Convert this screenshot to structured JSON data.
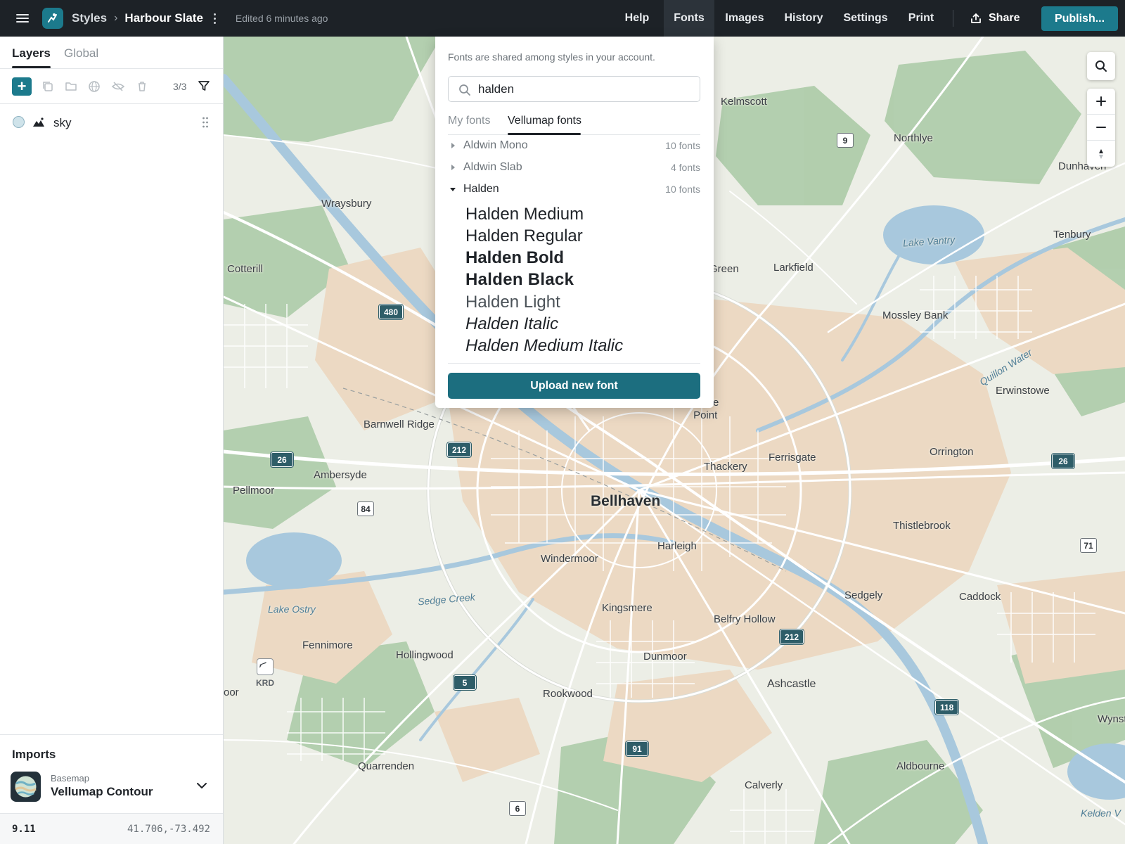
{
  "header": {
    "breadcrumb_root": "Styles",
    "breadcrumb_sep": "›",
    "style_name": "Harbour Slate",
    "edited": "Edited 6 minutes ago",
    "nav": [
      "Help",
      "Fonts",
      "Images",
      "History",
      "Settings",
      "Print"
    ],
    "active_nav": "Fonts",
    "share_label": "Share",
    "publish_label": "Publish..."
  },
  "left_panel": {
    "tabs": [
      "Layers",
      "Global"
    ],
    "active_tab": "Layers",
    "layer_count": "3/3",
    "layers": [
      {
        "name": "sky",
        "type_icon": "mountain-icon"
      }
    ],
    "imports_title": "Imports",
    "basemap_label": "Basemap",
    "basemap_name": "Vellumap Contour",
    "zoom": "9.11",
    "coordinates": "41.706,-73.492"
  },
  "font_panel": {
    "note": "Fonts are shared among styles in your account.",
    "search_value": "halden",
    "tabs": [
      "My fonts",
      "Vellumap fonts"
    ],
    "active_tab": "Vellumap fonts",
    "families": [
      {
        "name": "Aldwin Mono",
        "count": "10 fonts",
        "expanded": false
      },
      {
        "name": "Aldwin Slab",
        "count": "4 fonts",
        "expanded": false
      },
      {
        "name": "Halden",
        "count": "10 fonts",
        "expanded": true
      }
    ],
    "variants": [
      {
        "name": "Halden Medium",
        "weight": 500,
        "style": "normal"
      },
      {
        "name": "Halden Regular",
        "weight": 400,
        "style": "normal"
      },
      {
        "name": "Halden Bold",
        "weight": 700,
        "style": "normal"
      },
      {
        "name": "Halden Black",
        "weight": 900,
        "style": "normal"
      },
      {
        "name": "Halden Light",
        "weight": 300,
        "style": "normal"
      },
      {
        "name": "Halden Italic",
        "weight": 400,
        "style": "italic"
      },
      {
        "name": "Halden Medium Italic",
        "weight": 500,
        "style": "italic"
      }
    ],
    "upload_label": "Upload new font"
  },
  "map": {
    "places": {
      "kelmscott": "Kelmscott",
      "northlye": "Northlye",
      "dunhaven": "Dunhaven",
      "wraysbury": "Wraysbury",
      "tenbury": "Tenbury",
      "cotterill": "Cotterill",
      "green": "Green",
      "larkfield": "Larkfield",
      "mossley_bank": "Mossley Bank",
      "erwinstowe": "Erwinstowe",
      "rowe_point": "Rowe\nPoint",
      "barnwell_ridge": "Barnwell Ridge",
      "orrington": "Orrington",
      "ferrisgate": "Ferrisgate",
      "thackery": "Thackery",
      "ambersyde": "Ambersyde",
      "pellmoor": "Pellmoor",
      "bellhaven": "Bellhaven",
      "thistlebrook": "Thistlebrook",
      "harleigh": "Harleigh",
      "windermoor": "Windermoor",
      "sedgely": "Sedgely",
      "caddock": "Caddock",
      "kingsmere": "Kingsmere",
      "belfry_hollow": "Belfry Hollow",
      "fennimore": "Fennimore",
      "hollingwood": "Hollingwood",
      "dunmoor": "Dunmoor",
      "ashcastle": "Ashcastle",
      "rookwood": "Rookwood",
      "wynst": "Wynst",
      "oor": "oor",
      "quarrenden": "Quarrenden",
      "aldbourne": "Aldbourne",
      "calverly": "Calverly",
      "kelden": "Kelden V",
      "airport_code": "KRD"
    },
    "water_labels": {
      "lake_vantry": "Lake Vantry",
      "quillon_water": "Quillon Water",
      "sedge_creek": "Sedge Creek",
      "lake_ostry": "Lake Ostry"
    },
    "shields": {
      "r9": "9",
      "r480": "480",
      "r212a": "212",
      "r26a": "26",
      "r26b": "26",
      "r84": "84",
      "r71": "71",
      "r212b": "212",
      "r5": "5",
      "r118": "118",
      "r91": "91",
      "r6": "6"
    },
    "colors": {
      "land": "#eceee6",
      "park": "#a9c9a4",
      "urban": "#ecd9c3",
      "water": "#a8c8dd",
      "road": "#ffffff",
      "accent": "#1c7a8c"
    }
  }
}
